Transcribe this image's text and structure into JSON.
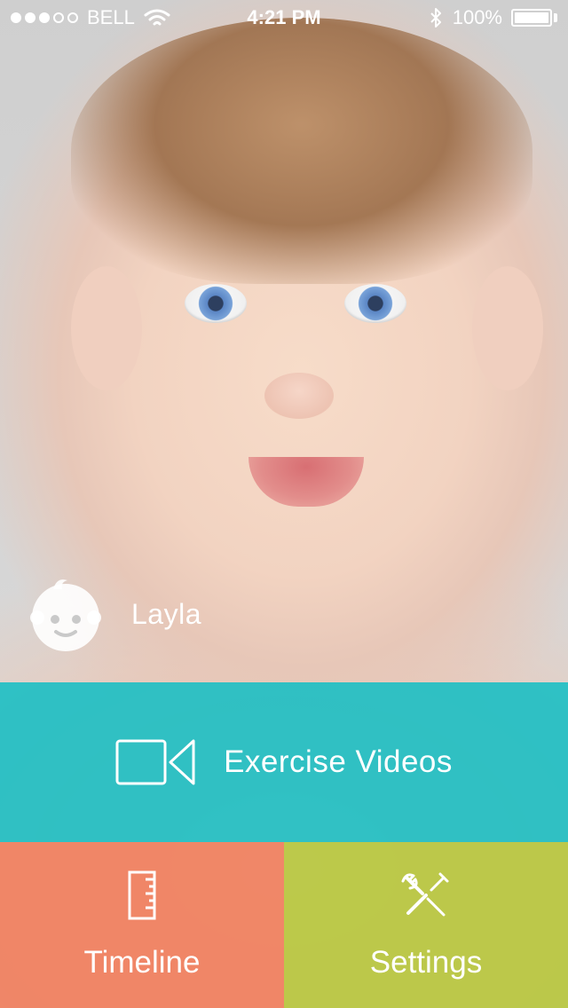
{
  "status_bar": {
    "carrier": "BELL",
    "time": "4:21 PM",
    "battery": "100%"
  },
  "profile": {
    "name": "Layla"
  },
  "menu": {
    "exercise_videos": "Exercise Videos",
    "timeline": "Timeline",
    "settings": "Settings"
  },
  "icons": {
    "signal": "signal-dots-icon",
    "wifi": "wifi-icon",
    "bluetooth": "bluetooth-icon",
    "battery": "battery-icon",
    "avatar": "baby-face-icon",
    "video": "video-camera-icon",
    "timeline": "ruler-icon",
    "settings": "wrench-screwdriver-icon"
  },
  "colors": {
    "exercise_panel": "#16BEC4",
    "timeline_panel": "#F0805F",
    "settings_panel": "#B7C840"
  }
}
